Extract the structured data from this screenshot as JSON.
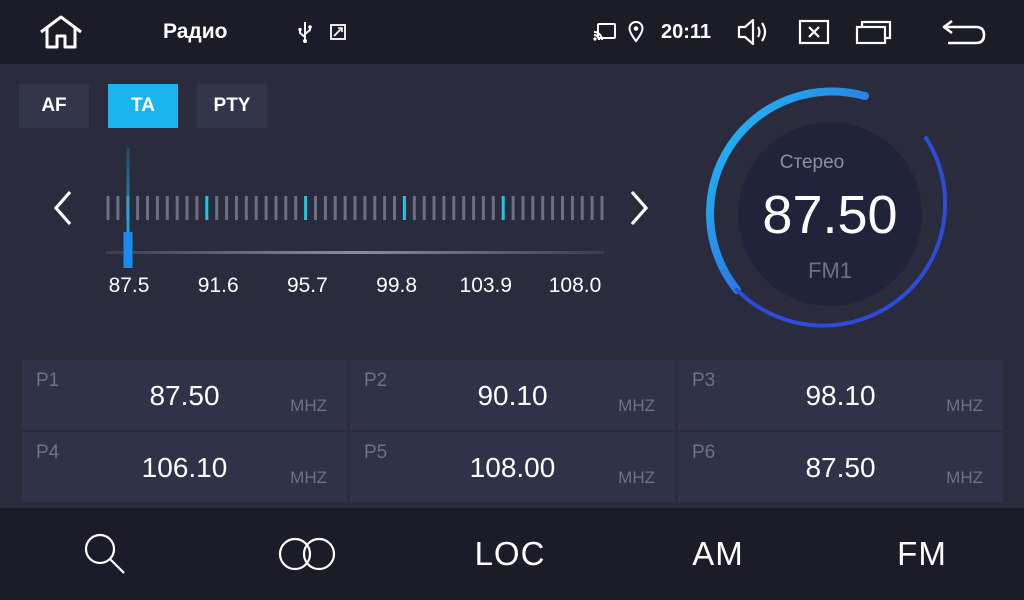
{
  "header": {
    "title": "Радио",
    "clock": "20:11",
    "icons": [
      "home-icon",
      "usb-icon",
      "screen-capture-icon",
      "cast-icon",
      "location-icon",
      "volume-icon",
      "close-icon",
      "windows-icon",
      "back-icon"
    ]
  },
  "modes": [
    {
      "label": "AF",
      "active": false
    },
    {
      "label": "TA",
      "active": true
    },
    {
      "label": "PTY",
      "active": false
    }
  ],
  "scale": {
    "labels": [
      "87.5",
      "91.6",
      "95.7",
      "99.8",
      "103.9",
      "108.0"
    ],
    "min": 87.5,
    "max": 108.0,
    "current": 87.5
  },
  "dial": {
    "mode": "Стерео",
    "frequency": "87.50",
    "band": "FM1"
  },
  "presets": [
    {
      "label": "P1",
      "freq": "87.50",
      "unit": "MHZ"
    },
    {
      "label": "P2",
      "freq": "90.10",
      "unit": "MHZ"
    },
    {
      "label": "P3",
      "freq": "98.10",
      "unit": "MHZ"
    },
    {
      "label": "P4",
      "freq": "106.10",
      "unit": "MHZ"
    },
    {
      "label": "P5",
      "freq": "108.00",
      "unit": "MHZ"
    },
    {
      "label": "P6",
      "freq": "87.50",
      "unit": "MHZ"
    }
  ],
  "bottom": {
    "loc": "LOC",
    "am": "AM",
    "fm": "FM"
  },
  "colors": {
    "accent": "#1ab4f0",
    "ring_start": "#1fc3f5",
    "ring_end": "#2d4bd6"
  }
}
